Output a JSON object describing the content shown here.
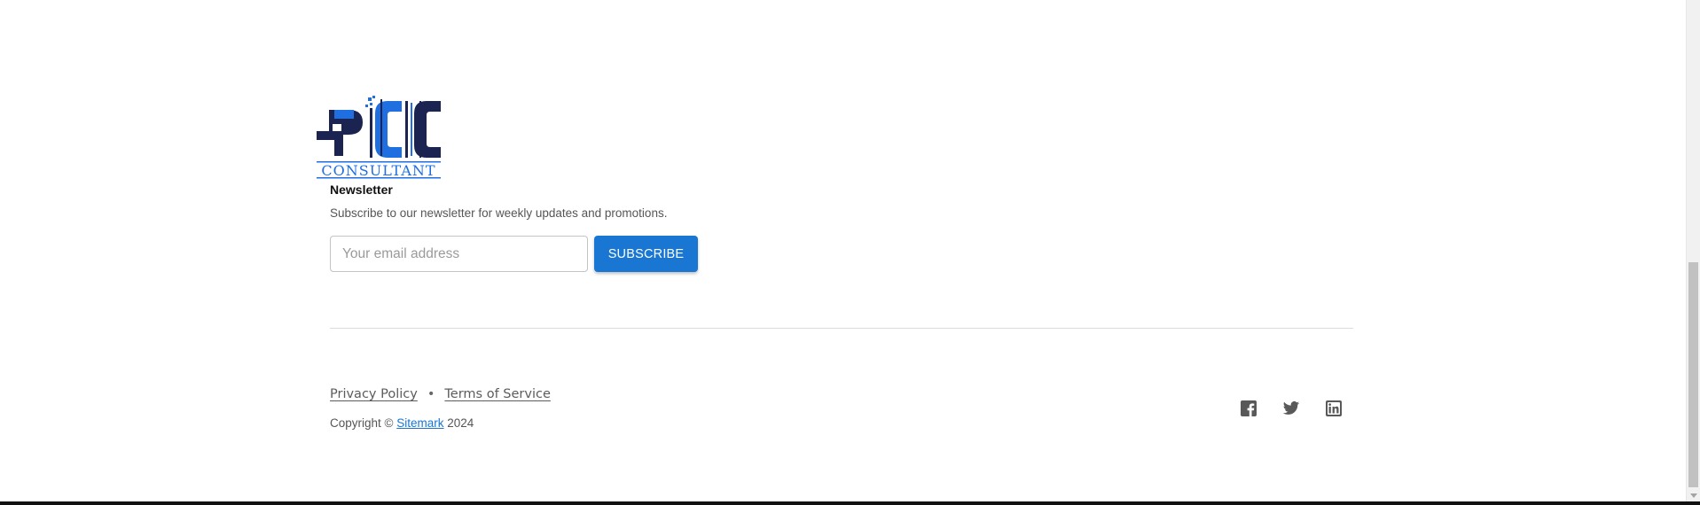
{
  "logo": {
    "text": "CONSULTANT",
    "letters": "PCC",
    "colors": {
      "navy": "#1b2350",
      "blue": "#1f6fe0"
    }
  },
  "newsletter": {
    "heading": "Newsletter",
    "description": "Subscribe to our newsletter for weekly updates and promotions.",
    "email_placeholder": "Your email address",
    "email_value": "",
    "subscribe_label": "SUBSCRIBE"
  },
  "footer": {
    "privacy_label": "Privacy Policy",
    "separator": "•",
    "terms_label": "Terms of Service",
    "copyright_prefix": "Copyright ©",
    "copyright_link": "Sitemark",
    "copyright_year": "2024",
    "social": [
      {
        "name": "facebook-icon"
      },
      {
        "name": "twitter-icon"
      },
      {
        "name": "linkedin-icon"
      }
    ]
  },
  "colors": {
    "accent": "#1976d2",
    "text_muted": "#555555",
    "icon": "#595959"
  }
}
